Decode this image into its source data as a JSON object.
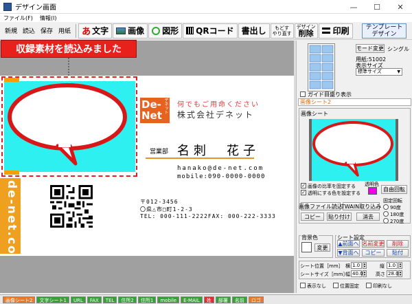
{
  "window": {
    "title": "デザイン画面",
    "minimize": "—",
    "maximize": "☐",
    "close": "✕"
  },
  "menu": [
    "ファイル(F)",
    "情報(I)"
  ],
  "toolbar": {
    "new": "新規",
    "load": "読込",
    "save": "保存",
    "paper": "用紙",
    "text": "文字",
    "image": "画像",
    "shape": "図形",
    "qr": "QRコード",
    "write": "書出し",
    "undo_top": "もどす",
    "undo_bottom": "やり直す",
    "design_top": "デザイン",
    "design_bottom": "削除",
    "print": "印刷",
    "template_top": "テンプレート",
    "template_bottom": "デザイン"
  },
  "callout": "収録素材を読込みました",
  "card": {
    "logo": "De-\nNet",
    "logo_sub": "デネット",
    "slogan": "何でもご用命ください",
    "company": "株式会社デネット",
    "dept": "営業部",
    "name": "名刺　花子",
    "email": "hanako@de-net.com",
    "mobile": "mobile:090-0000-0000",
    "zip": "〒012-3456",
    "address": "〇県△市□町1-2-3",
    "phone": "TEL: 000-111-2222FAX: 000-222-3333",
    "vertical": "de-net.co"
  },
  "panel": {
    "mode_change": "モード変更",
    "single": "シングル",
    "paper_label": "用紙:51002",
    "display_size_label": "表示サイズ",
    "display_size_value": "標準サイズ",
    "guide_check": "ガイド目盛り表示",
    "sheet_tab": "画像シート2",
    "sheet_group": "画像シート",
    "keep_ratio": "画像の比率を固定する",
    "transparent_check": "透明にする色を設定する",
    "transparent_color_label": "透明色",
    "free_rotate": "自由回転",
    "load_file": "画像ファイル読込",
    "twain": "TWAIN取り込み",
    "copy": "コピー",
    "paste": "貼り付け",
    "erase": "消去",
    "rotate_group": "固定回転",
    "rot_90": "90度",
    "rot_180": "180度",
    "rot_270": "270度",
    "bg_group": "背景色",
    "bg_change": "変更",
    "sheet_settings": "シート設定",
    "to_front": "▲前面へ",
    "rename": "名前変更",
    "delete": "削除",
    "to_back": "▼背面へ",
    "sheet_copy": "コピー",
    "sheet_paste": "貼付",
    "pos_label": "シート位置［mm］",
    "x_label": "横",
    "x_value": "1.0",
    "y_label": "縦",
    "y_value": "1.0",
    "size_label": "シートサイズ［mm］",
    "w_label": "幅",
    "w_value": "40.0",
    "h_label": "高さ",
    "h_value": "28.0",
    "hide": "表示なし",
    "lock_pos": "位置固定",
    "no_print": "印刷なし"
  },
  "tabs": [
    {
      "label": "画像シート2",
      "color": "#f07820"
    },
    {
      "label": "文字シート1",
      "color": "#38a038"
    },
    {
      "label": "URL",
      "color": "#38a038"
    },
    {
      "label": "FAX",
      "color": "#38a038"
    },
    {
      "label": "TEL",
      "color": "#38a038"
    },
    {
      "label": "住所2",
      "color": "#38a038"
    },
    {
      "label": "住所1",
      "color": "#38a038"
    },
    {
      "label": "mobile",
      "color": "#38a038"
    },
    {
      "label": "E-MAIL",
      "color": "#38a038"
    },
    {
      "label": "姓",
      "color": "#d83030"
    },
    {
      "label": "部署",
      "color": "#38a038"
    },
    {
      "label": "名前",
      "color": "#38a038"
    },
    {
      "label": "ロゴ",
      "color": "#f07820"
    }
  ]
}
